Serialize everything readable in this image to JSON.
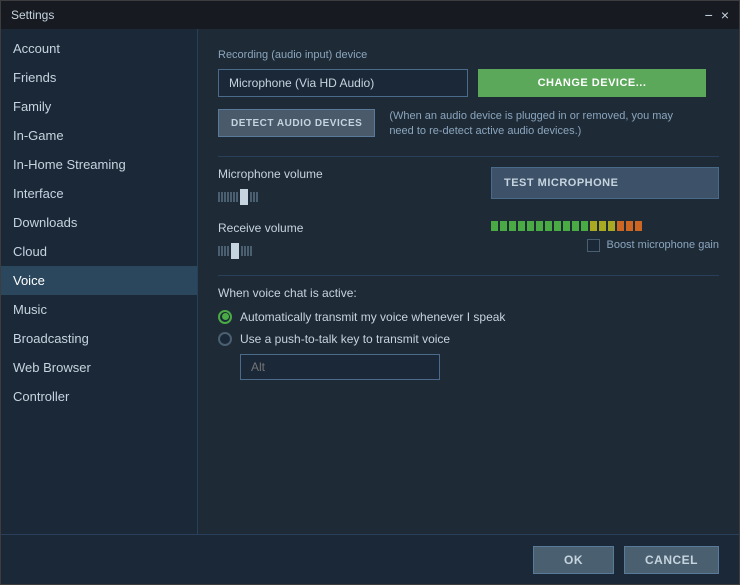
{
  "window": {
    "title": "Settings",
    "close_label": "×",
    "minimize_label": "−"
  },
  "sidebar": {
    "items": [
      {
        "id": "account",
        "label": "Account",
        "active": false
      },
      {
        "id": "friends",
        "label": "Friends",
        "active": false
      },
      {
        "id": "family",
        "label": "Family",
        "active": false
      },
      {
        "id": "in-game",
        "label": "In-Game",
        "active": false
      },
      {
        "id": "in-home-streaming",
        "label": "In-Home Streaming",
        "active": false
      },
      {
        "id": "interface",
        "label": "Interface",
        "active": false
      },
      {
        "id": "downloads",
        "label": "Downloads",
        "active": false
      },
      {
        "id": "cloud",
        "label": "Cloud",
        "active": false
      },
      {
        "id": "voice",
        "label": "Voice",
        "active": true
      },
      {
        "id": "music",
        "label": "Music",
        "active": false
      },
      {
        "id": "broadcasting",
        "label": "Broadcasting",
        "active": false
      },
      {
        "id": "web-browser",
        "label": "Web Browser",
        "active": false
      },
      {
        "id": "controller",
        "label": "Controller",
        "active": false
      }
    ]
  },
  "content": {
    "recording_label": "Recording (audio input) device",
    "device_value": "Microphone (Via HD Audio)",
    "change_device_btn": "CHANGE DEVICE...",
    "detect_btn": "DETECT AUDIO DEVICES",
    "detect_note": "(When an audio device is plugged in or removed, you may need to re-detect active audio devices.)",
    "microphone_volume_label": "Microphone volume",
    "test_microphone_btn": "TEST MICROPHONE",
    "receive_volume_label": "Receive volume",
    "boost_label": "Boost microphone gain",
    "voice_chat_label": "When voice chat is active:",
    "radio_option1": "Automatically transmit my voice whenever I speak",
    "radio_option2": "Use a push-to-talk key to transmit voice",
    "keybind_placeholder": "Alt"
  },
  "footer": {
    "ok_label": "OK",
    "cancel_label": "CANCEL"
  },
  "colors": {
    "accent_green": "#5ba85a",
    "accent_blue": "#2a475e",
    "border": "#2a3f5a"
  }
}
